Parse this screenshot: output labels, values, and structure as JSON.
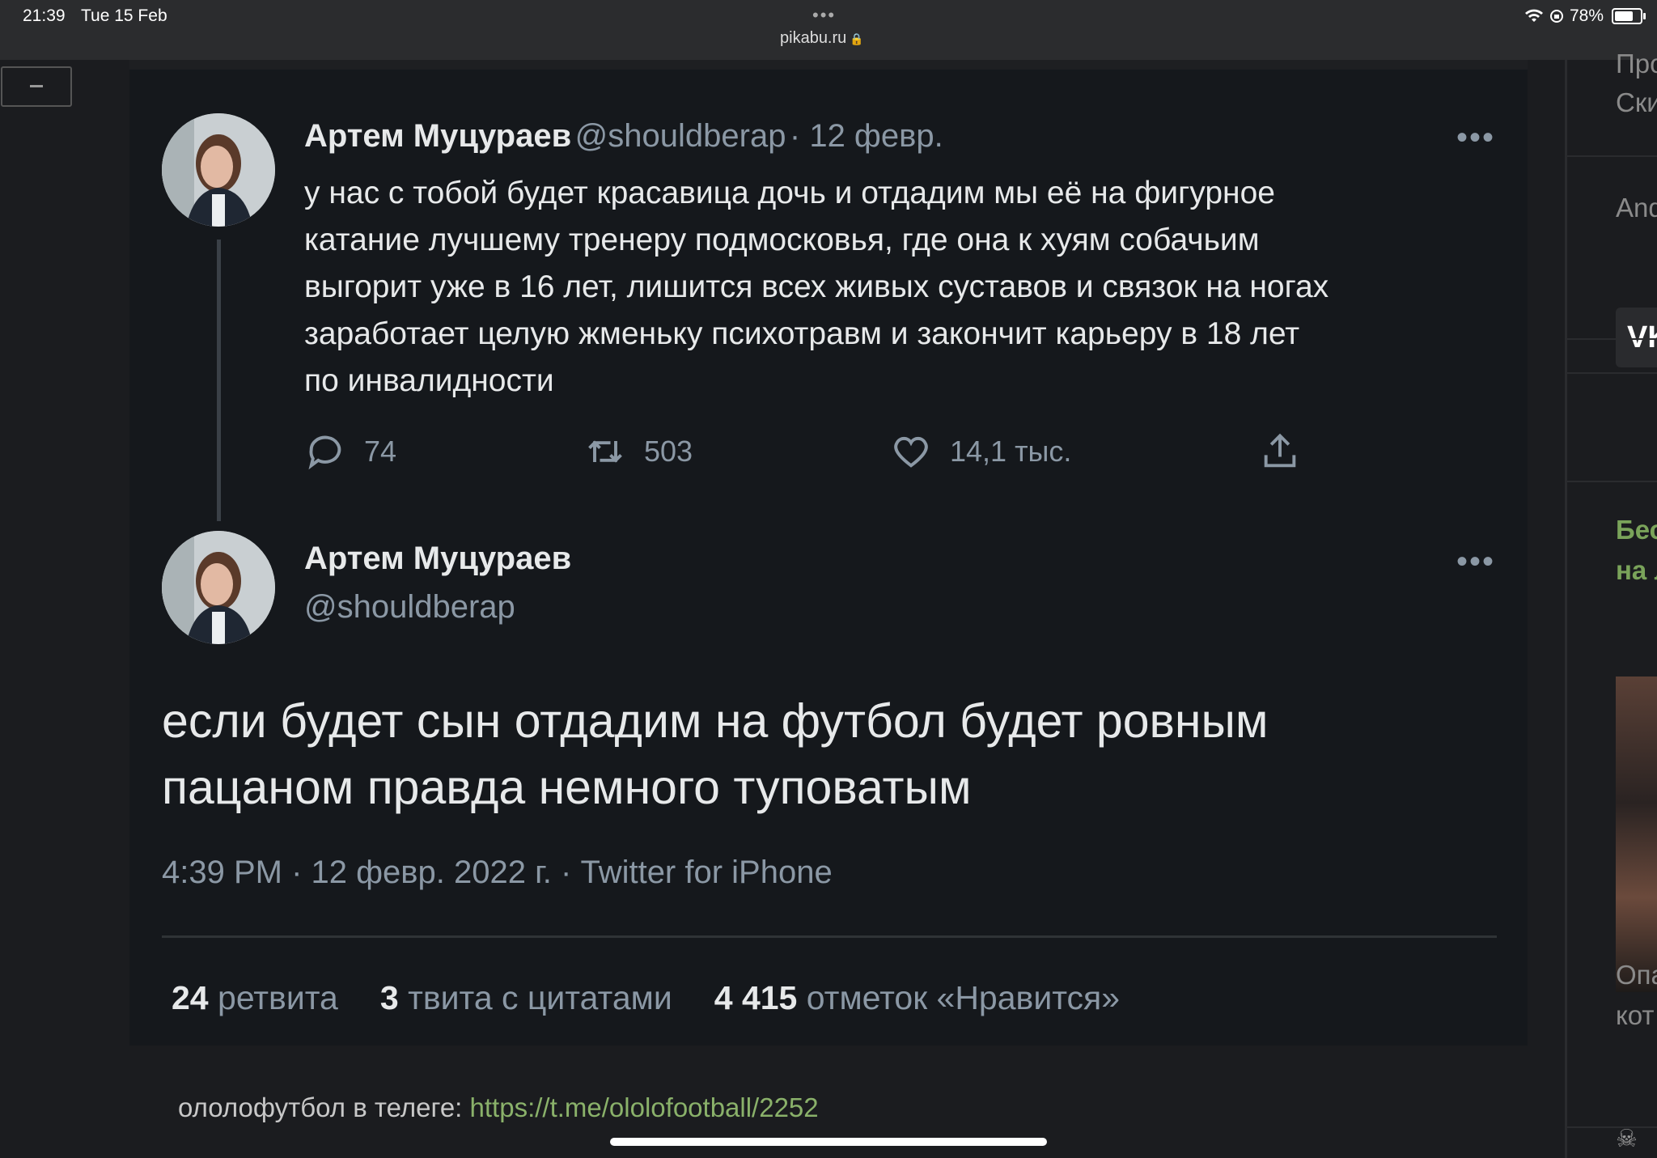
{
  "statusbar": {
    "time": "21:39",
    "date": "Tue 15 Feb",
    "url": "pikabu.ru",
    "battery": "78%"
  },
  "tweet1": {
    "author_name": "Артем Муцураев",
    "handle": "@shouldberap",
    "date": "12 февр.",
    "text_lines": [
      "у нас с тобой будет красавица дочь и отдадим мы её на фигурное",
      "катание лучшему тренеру подмосковья, где она к хуям собачьим",
      "выгорит уже в 16 лет, лишится всех живых суставов и связок на ногах",
      "заработает целую жменьку психотравм и закончит карьеру в 18 лет",
      "по инвалидности"
    ],
    "replies": "74",
    "retweets": "503",
    "likes": "14,1 тыс."
  },
  "tweet2": {
    "author_name": "Артем Муцураев",
    "handle": "@shouldberap",
    "text_lines": [
      "если будет сын отдадим на футбол будет ровным",
      "пацаном правда немного туповатым"
    ],
    "meta": "4:39 PM · 12 февр. 2022 г. · Twitter for iPhone",
    "stats": {
      "retweets_count": "24",
      "retweets_label": "ретвита",
      "quotes_count": "3",
      "quotes_label": "твита с цитатами",
      "likes_count": "4 415",
      "likes_label": "отметок «Нравится»"
    }
  },
  "caption": {
    "prefix": "ололофутбол в телеге: ",
    "link": "https://t.me/ololofootball/2252"
  },
  "sidebar": {
    "t1": "Про",
    "t2": "Ски",
    "t3": "And",
    "vk": "VK",
    "g1": "Бес",
    "g2": "на л",
    "t4": "Опа",
    "t5": "кот"
  },
  "colors": {
    "card_bg": "#15181c",
    "page_bg": "#1b1c1f",
    "link_green": "#8ab16a",
    "muted": "#8b98a5"
  }
}
